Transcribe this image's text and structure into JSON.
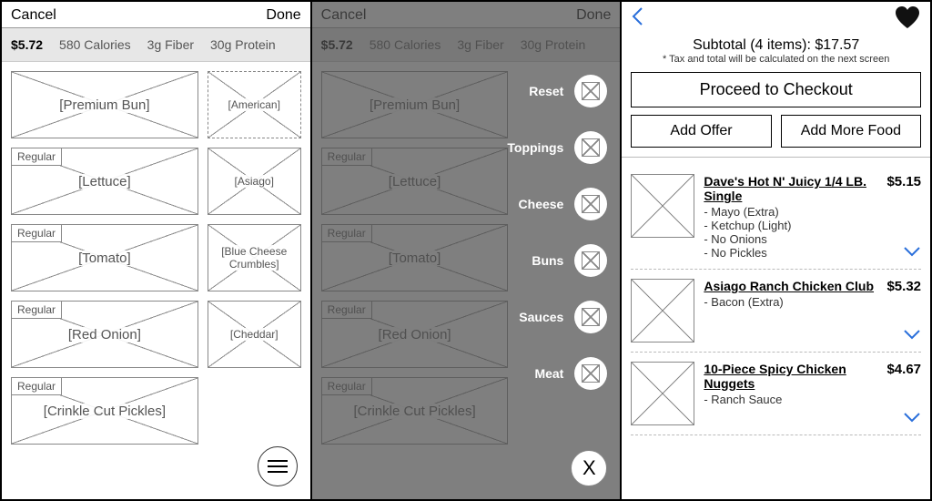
{
  "screen1": {
    "cancel": "Cancel",
    "done": "Done",
    "price": "$5.72",
    "cal": "580 Calories",
    "fiber": "3g Fiber",
    "protein": "30g Protein",
    "left": [
      {
        "label": "[Premium Bun]",
        "tag": null
      },
      {
        "label": "[Lettuce]",
        "tag": "Regular"
      },
      {
        "label": "[Tomato]",
        "tag": "Regular"
      },
      {
        "label": "[Red Onion]",
        "tag": "Regular"
      },
      {
        "label": "[Crinkle Cut Pickles]",
        "tag": "Regular"
      }
    ],
    "right": [
      {
        "label": "[American]",
        "dashed": true
      },
      {
        "label": "[Asiago]"
      },
      {
        "label": "[Blue Cheese Crumbles]"
      },
      {
        "label": "[Cheddar]"
      }
    ]
  },
  "screen2": {
    "cancel": "Cancel",
    "done": "Done",
    "price": "$5.72",
    "cal": "580 Calories",
    "fiber": "3g Fiber",
    "protein": "30g Protein",
    "categories": [
      "Reset",
      "Toppings",
      "Cheese",
      "Buns",
      "Sauces",
      "Meat"
    ],
    "close": "X"
  },
  "screen3": {
    "subtotal_label": "Subtotal (4 items): $17.57",
    "tax_note": "* Tax and total will be calculated on the next screen",
    "checkout": "Proceed to Checkout",
    "add_offer": "Add Offer",
    "add_more": "Add More Food",
    "items": [
      {
        "name": "Dave's Hot N' Juicy 1/4 LB. Single",
        "price": "$5.15",
        "mods": [
          "- Mayo (Extra)",
          "- Ketchup (Light)",
          "- No Onions",
          "- No Pickles"
        ]
      },
      {
        "name": "Asiago Ranch Chicken Club",
        "price": "$5.32",
        "mods": [
          "- Bacon (Extra)"
        ]
      },
      {
        "name": "10-Piece Spicy Chicken Nuggets",
        "price": "$4.67",
        "mods": [
          "- Ranch Sauce"
        ]
      }
    ]
  }
}
